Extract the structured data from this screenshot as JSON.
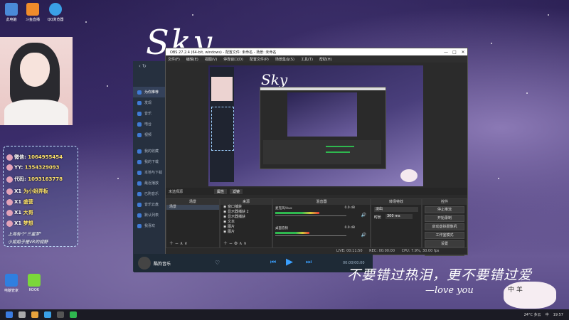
{
  "desktop": {
    "icons_left": [
      {
        "label": "此电脑",
        "icon": "computer-icon",
        "color": "#4a8ad8"
      },
      {
        "label": "斗鱼直播",
        "icon": "douyu-icon",
        "color": "#f08c2b"
      },
      {
        "label": "QQ浏览器",
        "icon": "qq-browser-icon",
        "color": "#3aa0e6"
      }
    ],
    "icons_bottom": [
      {
        "label": "电脑管家",
        "icon": "pc-manager-icon",
        "color": "#2f7fe0"
      },
      {
        "label": "KOOK",
        "icon": "kook-icon",
        "color": "#7bd73a"
      }
    ],
    "wallpaper_title": "Sky",
    "calligraphy": "不要错过热泪，更不要错过爱",
    "signature": "—love you",
    "sticker_text": "中 羊"
  },
  "gift_overlay": {
    "rows": [
      {
        "name": "微信",
        "value": "1064955454"
      },
      {
        "name": "YY",
        "value": "1354329093"
      },
      {
        "name": "代码",
        "value": "1093163778"
      },
      {
        "name": "X1",
        "value": "为小姐弄板"
      },
      {
        "name": "X1",
        "value": "盛营"
      },
      {
        "name": "X1",
        "value": "大哥"
      },
      {
        "name": "X1",
        "value": "梦想"
      }
    ],
    "footer_1": "上海有个\"三星梦\"",
    "footer_2": "小姐姐子是VR的视野"
  },
  "side_panel": {
    "items": [
      "为你推荐",
      "发现",
      "音乐",
      "电台",
      "视频",
      "我的收藏",
      "我的下载",
      "本地与下载",
      "最近播放",
      "已购音乐",
      "音乐云盘",
      "默认列表",
      "我喜欢"
    ]
  },
  "obs": {
    "title": "OBS 27.2.4 (64-bit, windows) - 配置文件: 未命名 - 场景: 未命名",
    "menu": [
      "文件(F)",
      "编辑(E)",
      "视图(V)",
      "停靠窗口(D)",
      "配置文件(P)",
      "场景集合(S)",
      "工具(T)",
      "帮助(H)"
    ],
    "scene_tabs": [
      "未选择源",
      "属性",
      "滤镜"
    ],
    "docks": {
      "scenes": {
        "header": "场景",
        "items": [
          "场景"
        ]
      },
      "sources": {
        "header": "来源",
        "items": [
          "窗口捕获",
          "显示器捕获 2",
          "显示器捕获",
          "文本",
          "图片",
          "图片"
        ]
      },
      "mixer": {
        "header": "混音器",
        "rows": [
          {
            "name": "麦克风/Aux",
            "level": "0.0 dB",
            "fill": 0.62
          },
          {
            "name": "桌面音频",
            "level": "0.0 dB",
            "fill": 0.48
          }
        ]
      },
      "transitions": {
        "header": "转场特效",
        "type": "淡出",
        "duration_label": "时长",
        "duration": "300 ms"
      },
      "controls": {
        "header": "控件",
        "buttons": [
          "停止推流",
          "开始录制",
          "启动虚拟摄像机",
          "工作室模式",
          "设置",
          "退出"
        ]
      }
    },
    "status": [
      "LIVE: 00:11:50",
      "REC: 00:00:00",
      "CPU: 7.9%, 30.00 fps"
    ]
  },
  "music_bar": {
    "title": "酷狗音乐",
    "time": "00:00/00:00"
  },
  "taskbar": {
    "weather": "24°C 多云",
    "time": "19:57",
    "lang": "中"
  },
  "colors": {
    "obs_bg": "#2b2b2b",
    "panel_bg": "#26303f",
    "music_accent": "#3aa0ff"
  }
}
